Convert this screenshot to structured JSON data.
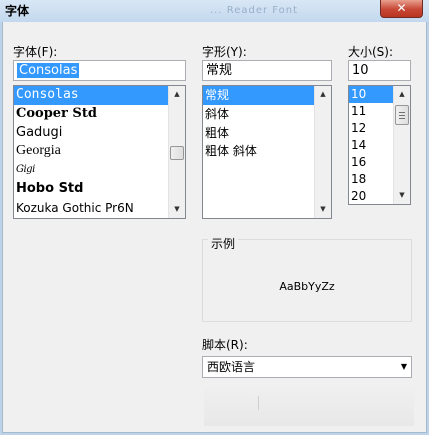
{
  "window": {
    "title": "字体",
    "title_blur": "... Reader Font",
    "close_glyph": "✕"
  },
  "font": {
    "label": "字体(F):",
    "value": "Consolas",
    "items": [
      "Consolas",
      "Cooper Std",
      "Gadugi",
      "Georgia",
      "Gigi",
      "Hobo Std",
      "Kozuka Gothic Pr6N"
    ],
    "selected": "Consolas"
  },
  "style": {
    "label": "字形(Y):",
    "value": "常规",
    "items": [
      "常规",
      "斜体",
      "粗体",
      "粗体 斜体"
    ],
    "selected": "常规"
  },
  "size": {
    "label": "大小(S):",
    "value": "10",
    "items": [
      "10",
      "11",
      "12",
      "14",
      "16",
      "18",
      "20"
    ],
    "selected": "10"
  },
  "sample": {
    "label": "示例",
    "text": "AaBbYyZz"
  },
  "script": {
    "label": "脚本(R):",
    "value": "西欧语言"
  },
  "scroll": {
    "up_glyph": "▲",
    "down_glyph": "▼",
    "combo_arrow": "▼"
  },
  "colors": {
    "selection": "#3399ff",
    "dialog_bg": "#f0f0f0",
    "title_bg": "#c3d8ee"
  }
}
